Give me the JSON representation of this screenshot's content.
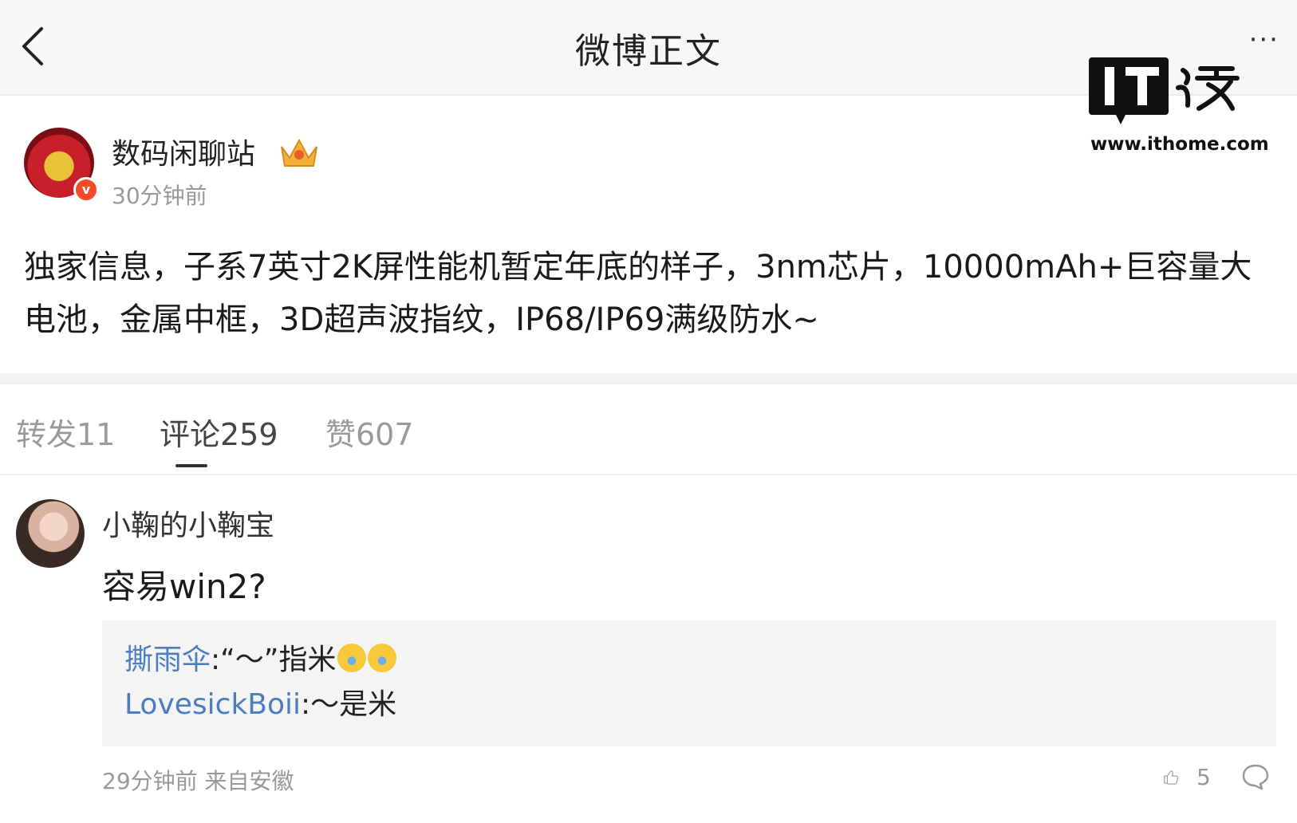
{
  "header": {
    "title": "微博正文"
  },
  "watermark": {
    "logo_text": "IT之家",
    "url": "www.ithome.com"
  },
  "post": {
    "author": "数码闲聊站",
    "time": "30分钟前",
    "content": "独家信息，子系7英寸2K屏性能机暂定年底的样子，3nm芯片，10000mAh+巨容量大电池，金属中框，3D超声波指纹，IP68/IP69满级防水~"
  },
  "tabs": [
    {
      "label": "转发11"
    },
    {
      "label": "评论259"
    },
    {
      "label": "赞607"
    }
  ],
  "comment": {
    "user": "小鞠的小鞠宝",
    "text": "容易win2?",
    "replies": [
      {
        "name": "撕雨伞",
        "text": ":“～”指米"
      },
      {
        "name": "LovesickBoii",
        "text": ":～是米"
      }
    ],
    "meta": "29分钟前 来自安徽",
    "likes": "5"
  },
  "colors": {
    "link": "#4c7ebf",
    "muted": "#999999",
    "badge": "#f24a27"
  },
  "icons": [
    "back-arrow-icon",
    "more-dots-icon",
    "crown-icon",
    "verified-icon",
    "thumbs-up-icon",
    "comment-bubble-icon",
    "laughing-emoji-icon"
  ]
}
